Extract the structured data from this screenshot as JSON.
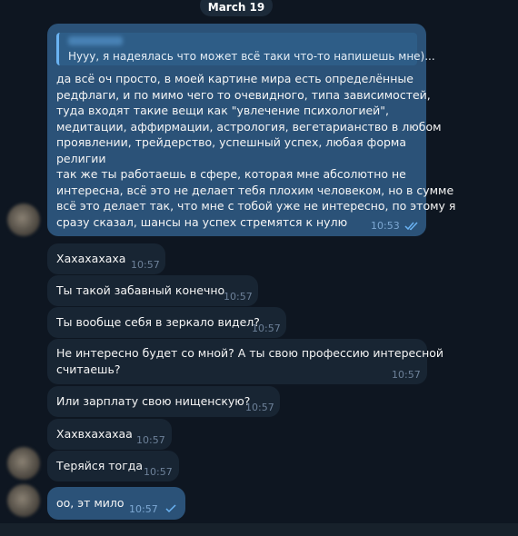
{
  "date_divider": "March 19",
  "messages": [
    {
      "id": "m1",
      "direction": "outgoing",
      "reply_preview": "Нууу, я надеялась что может всё таки что-то напишешь мне)...",
      "lines": [
        "да всё оч просто, в моей картине мира есть определённые",
        "редфлаги, и по мимо чего то очевидного, типа зависимостей,",
        "туда входят такие вещи как \"увлечение психологией\",",
        "медитации, аффирмации, астрология, вегетарианство в любом",
        "проявлении, трейдерство, успешный успех, любая форма",
        "религии",
        "так же ты работаешь в сфере, которая мне абсолютно не",
        "интересна, всё это не делает тебя плохим человеком, но в сумме",
        "всё это делает так, что мне с тобой уже не интересно, по этому я",
        "сразу сказал, шансы на успех стремятся к нулю"
      ],
      "time": "10:53",
      "status": "read"
    },
    {
      "id": "m2",
      "direction": "incoming",
      "text": "Хахахахаха",
      "time": "10:57"
    },
    {
      "id": "m3",
      "direction": "incoming",
      "text": "Ты такой забавный конечно",
      "time": "10:57"
    },
    {
      "id": "m4",
      "direction": "incoming",
      "text": "Ты вообще себя в зеркало видел?",
      "time": "10:57"
    },
    {
      "id": "m5",
      "direction": "incoming",
      "lines": [
        "Не интересно будет со мной? А ты свою профессию интересной",
        "считаешь?"
      ],
      "time": "10:57"
    },
    {
      "id": "m6",
      "direction": "incoming",
      "text": "Или зарплату свою нищенскую?",
      "time": "10:57"
    },
    {
      "id": "m7",
      "direction": "incoming",
      "text": "Хахвхахахаа",
      "time": "10:57"
    },
    {
      "id": "m8",
      "direction": "incoming",
      "text": "Теряйся тогда",
      "time": "10:57"
    },
    {
      "id": "m9",
      "direction": "outgoing",
      "text": "оо, эт мило",
      "time": "10:57",
      "status": "sent"
    }
  ],
  "colors": {
    "background": "#0e1621",
    "incoming_bubble": "#182533",
    "outgoing_bubble": "#2b5278",
    "accent": "#6ab3f3"
  }
}
